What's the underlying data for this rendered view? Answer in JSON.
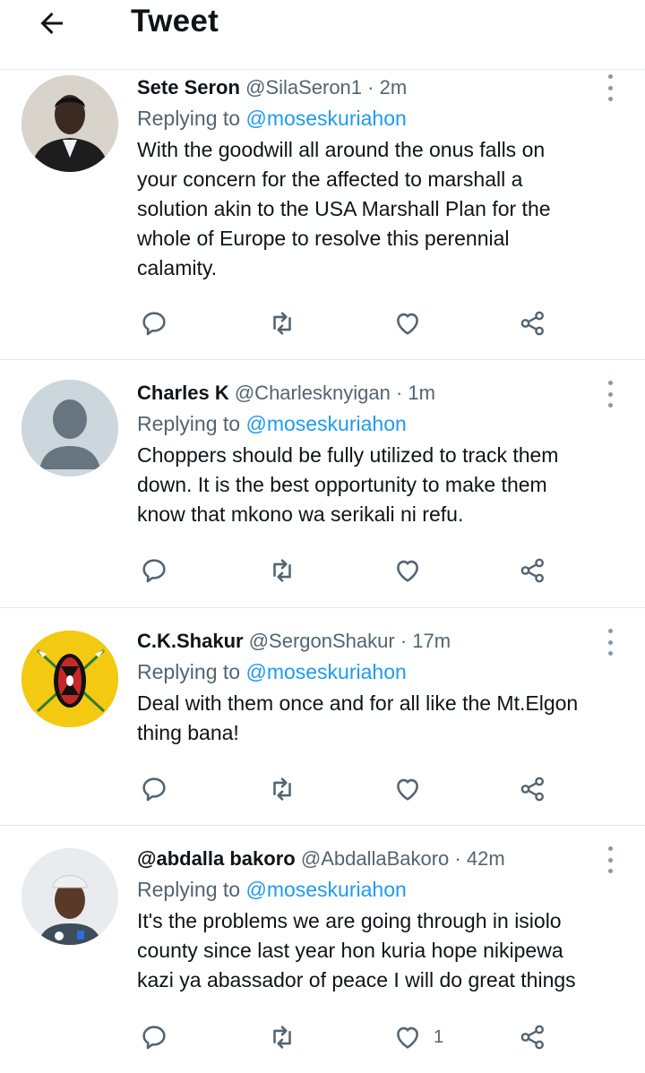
{
  "header": {
    "title": "Tweet",
    "back_icon": "arrow-left-icon"
  },
  "colors": {
    "accent": "#1d9bf0",
    "secondary_text": "#536471",
    "primary_text": "#0f1419",
    "icon": "#536471"
  },
  "tweets": [
    {
      "name": "Sete Seron",
      "handle": "@SilaSeron1",
      "time": "· 2m",
      "replying_prefix": "Replying to ",
      "replying_to": "@moseskuriahon",
      "text_lines": [
        "With the goodwill all around the onus falls on",
        "your concern for the affected to marshall a",
        "solution akin to the USA Marshall Plan for the",
        "whole of Europe to resolve this perennial",
        "calamity."
      ],
      "like_count": ""
    },
    {
      "name": "Charles K",
      "handle": "@Charlesknyigan",
      "time": "· 1m",
      "replying_prefix": "Replying to ",
      "replying_to": "@moseskuriahon",
      "text_lines": [
        "Choppers should be fully utilized to track them",
        "down. It is the best opportunity to make them",
        "know that mkono wa serikali ni refu."
      ],
      "like_count": ""
    },
    {
      "name": "C.K.Shakur",
      "handle": "@SergonShakur",
      "time": "· 17m",
      "replying_prefix": "Replying to ",
      "replying_to": "@moseskuriahon",
      "text_lines": [
        "Deal with them once and for all like the Mt.Elgon",
        "thing bana!"
      ],
      "like_count": ""
    },
    {
      "name": "@abdalla bakoro",
      "handle": "@AbdallaBakoro",
      "time": "· 42m",
      "replying_prefix": "Replying to ",
      "replying_to": "@moseskuriahon",
      "text_lines": [
        "It's the problems we are going through in isiolo",
        "county since last year hon kuria hope nikipewa",
        "kazi ya abassador of peace I will do great things"
      ],
      "like_count": "1"
    }
  ]
}
